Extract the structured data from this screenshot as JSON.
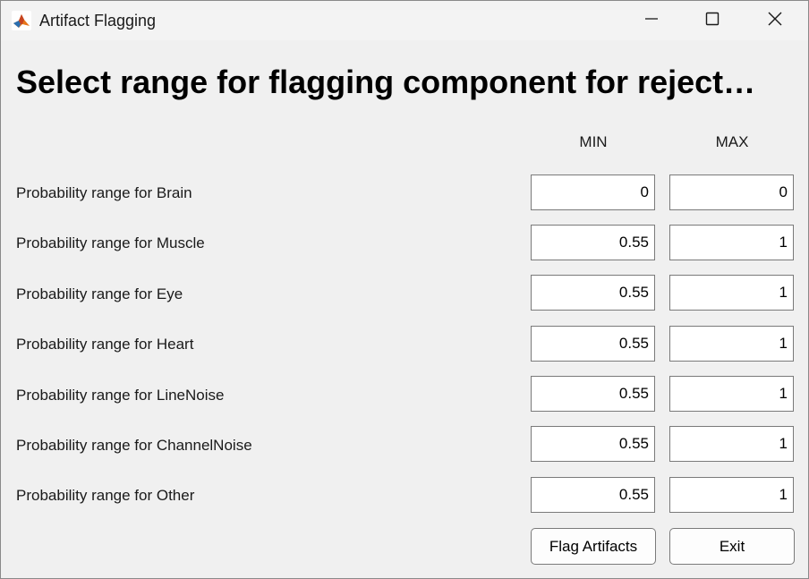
{
  "window": {
    "title": "Artifact Flagging"
  },
  "heading": "Select range for flagging component for reject…",
  "columns": {
    "min": "MIN",
    "max": "MAX"
  },
  "rows": [
    {
      "label": "Probability range for Brain",
      "min": "0",
      "max": "0"
    },
    {
      "label": "Probability range for Muscle",
      "min": "0.55",
      "max": "1"
    },
    {
      "label": "Probability range for Eye",
      "min": "0.55",
      "max": "1"
    },
    {
      "label": "Probability range for Heart",
      "min": "0.55",
      "max": "1"
    },
    {
      "label": "Probability range for LineNoise",
      "min": "0.55",
      "max": "1"
    },
    {
      "label": "Probability range for ChannelNoise",
      "min": "0.55",
      "max": "1"
    },
    {
      "label": "Probability range for Other",
      "min": "0.55",
      "max": "1"
    }
  ],
  "buttons": {
    "flag": "Flag Artifacts",
    "exit": "Exit"
  },
  "icons": {
    "app": "matlab-icon",
    "minimize": "minimize-icon",
    "maximize": "maximize-icon",
    "close": "close-icon"
  }
}
